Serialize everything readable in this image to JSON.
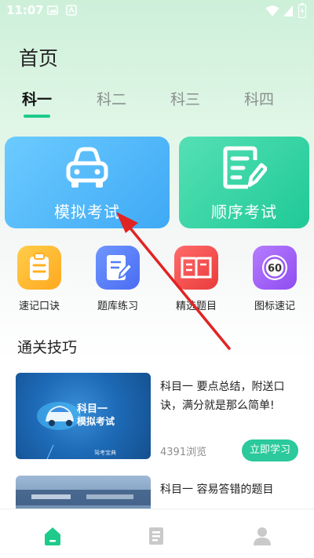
{
  "status_bar": {
    "time": "11:07"
  },
  "page": {
    "title": "首页"
  },
  "tabs": [
    {
      "label": "科一",
      "active": true
    },
    {
      "label": "科二",
      "active": false
    },
    {
      "label": "科三",
      "active": false
    },
    {
      "label": "科四",
      "active": false
    }
  ],
  "main_cards": [
    {
      "label": "模拟考试",
      "icon": "car-icon"
    },
    {
      "label": "顺序考试",
      "icon": "document-edit-icon"
    }
  ],
  "features": [
    {
      "label": "速记口诀",
      "icon": "clipboard-icon",
      "color": "#ffb020"
    },
    {
      "label": "题库练习",
      "icon": "edit-document-icon",
      "color": "#4f7bf7"
    },
    {
      "label": "精选题目",
      "icon": "book-icon",
      "color": "#f04a4a"
    },
    {
      "label": "图标速记",
      "icon": "speed-limit-60-icon",
      "color": "#9b59f5",
      "sign_text": "60"
    }
  ],
  "section": {
    "title": "通关技巧"
  },
  "articles": [
    {
      "title": "科目一 要点总结，附送口诀，满分就是那么简单!",
      "views": "4391浏览",
      "button": "立即学习",
      "thumb_text_1": "科目一",
      "thumb_text_2": "模拟考试",
      "thumb_caption": "驾考宝典"
    },
    {
      "title": "科目一 容易答错的题目"
    }
  ],
  "bottom_nav": [
    {
      "icon": "home-icon",
      "active": true
    },
    {
      "icon": "list-icon",
      "active": false
    },
    {
      "icon": "user-icon",
      "active": false
    }
  ],
  "colors": {
    "accent": "#1ecb8a",
    "mock_card": "#3fa9f5",
    "sequence_card": "#20c997"
  }
}
